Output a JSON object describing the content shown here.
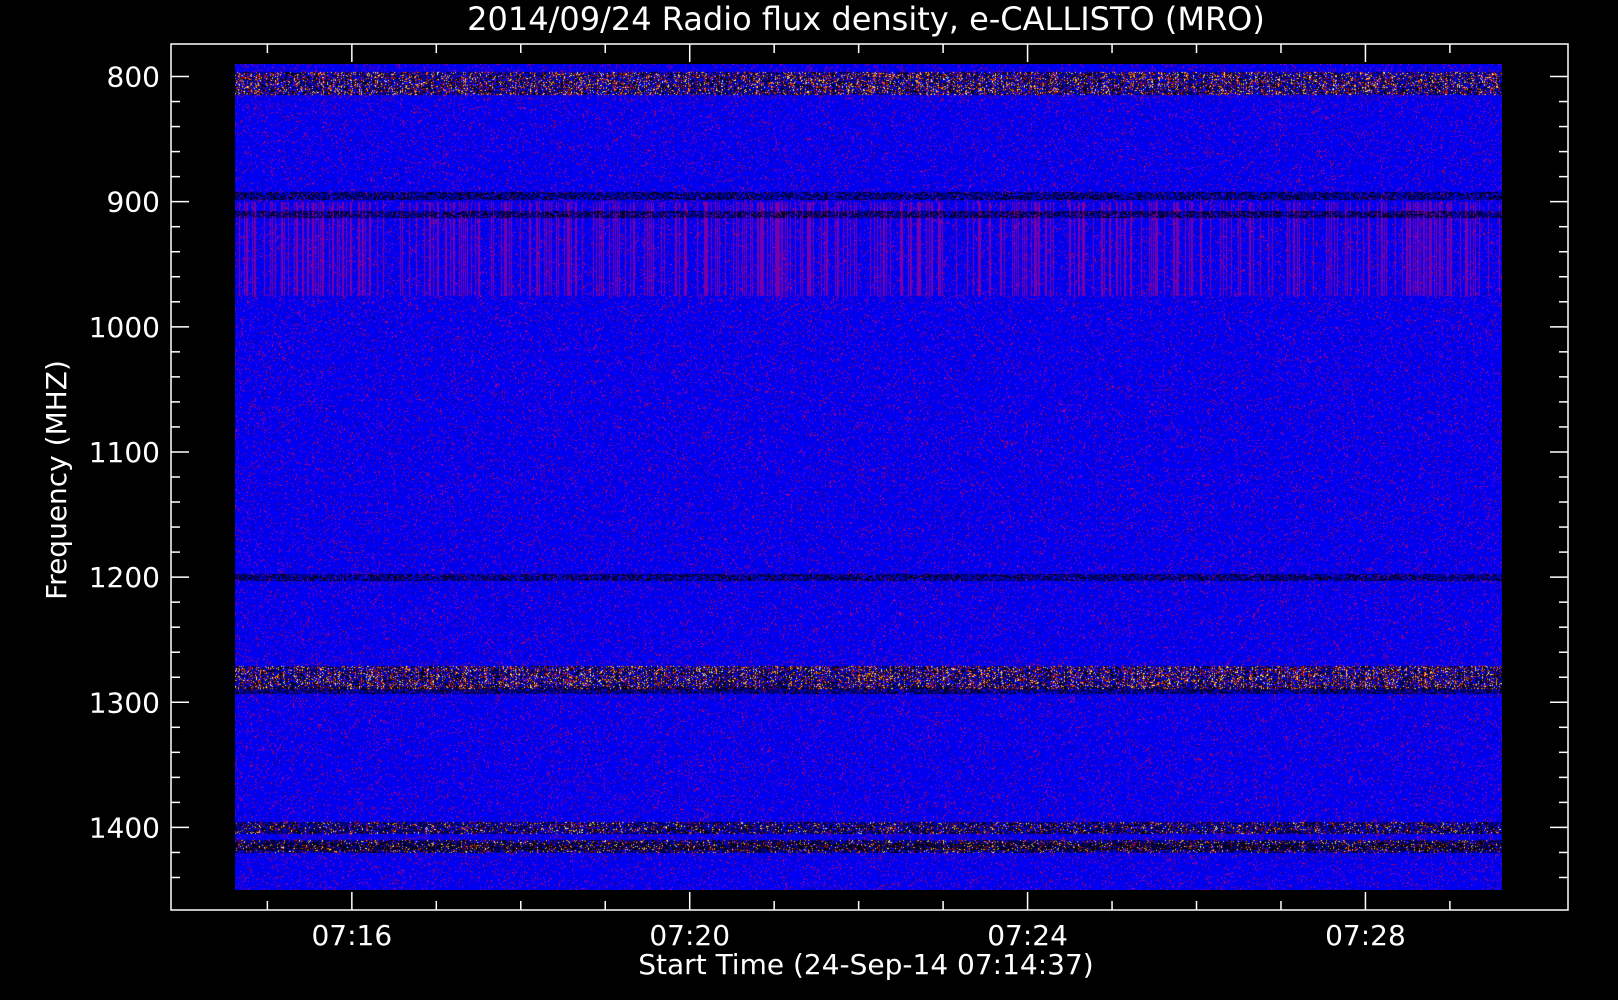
{
  "chart_data": {
    "type": "heatmap",
    "title": "2014/09/24  Radio flux density, e-CALLISTO (MRO)",
    "xlabel": "Start Time (24-Sep-14 07:14:37)",
    "ylabel": "Frequency (MHZ)",
    "x_ticks": [
      "07:16",
      "07:20",
      "07:24",
      "07:28"
    ],
    "y_ticks": [
      800,
      900,
      1000,
      1100,
      1200,
      1300,
      1400
    ],
    "x_range": [
      "07:14:37",
      "07:29:37"
    ],
    "y_range": [
      1450,
      790
    ],
    "y_inverted": true,
    "colors": {
      "background": "#0000ff",
      "cold": "#000030",
      "warm": "#cc1a00",
      "hot": "#ff9900",
      "hottest": "#ffffa0",
      "frame": "#ffffff"
    },
    "bright_bands_mhz": [
      {
        "freq": 805,
        "intensity": "high"
      },
      {
        "freq": 1280,
        "intensity": "high"
      },
      {
        "freq": 1400,
        "intensity": "moderate"
      },
      {
        "freq": 1415,
        "intensity": "moderate"
      }
    ],
    "dark_bands_mhz": [
      895,
      910,
      1200,
      1290,
      1415
    ]
  }
}
